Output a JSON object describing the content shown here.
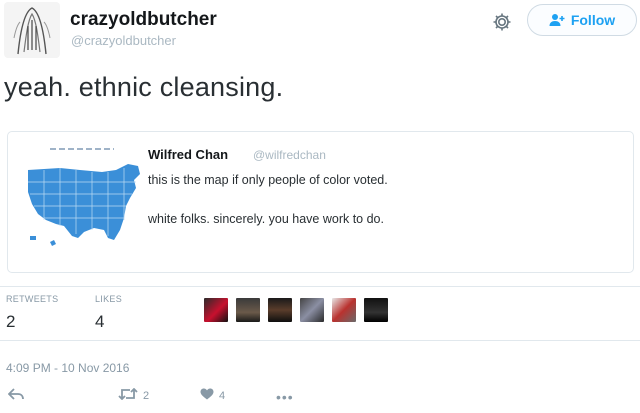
{
  "author": {
    "display_name": "crazyoldbutcher",
    "handle": "@crazyoldbutcher"
  },
  "actions_top": {
    "settings_icon": "gear-icon",
    "follow_label": "Follow",
    "follow_icon": "add-person-icon"
  },
  "tweet": {
    "text": "yeah. ethnic cleansing."
  },
  "quoted": {
    "name": "Wilfred Chan",
    "handle": "@wilfredchan",
    "line1": "this is the map if only people of color voted.",
    "line2": "white folks. sincerely. you have work to do.",
    "map_color": "#3b8fd8"
  },
  "stats": {
    "retweets_label": "RETWEETS",
    "retweets_value": "2",
    "likes_label": "LIKES",
    "likes_value": "4"
  },
  "likers": [
    "avatar-1",
    "avatar-2",
    "avatar-3",
    "avatar-4",
    "avatar-5",
    "avatar-6"
  ],
  "timestamp": "4:09 PM - 10 Nov 2016",
  "bottom_actions": {
    "reply_icon": "reply-icon",
    "retweet_count": "2",
    "like_count": "4",
    "more_label": "•••"
  },
  "colors": {
    "accent": "#1da1f2",
    "muted": "#8899a6",
    "border": "#e1e8ed"
  }
}
